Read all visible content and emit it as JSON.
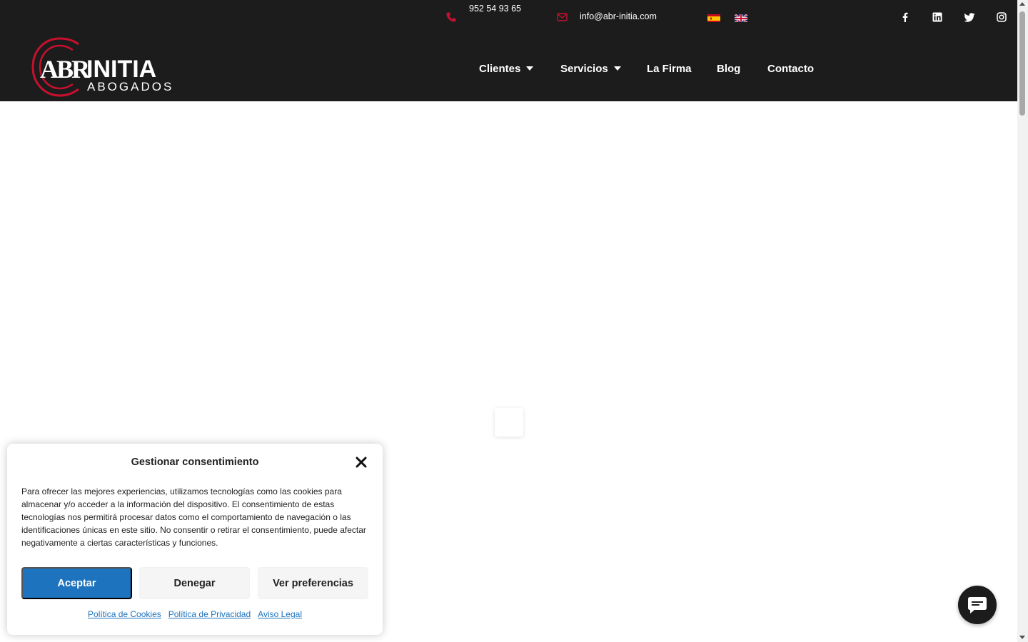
{
  "topbar": {
    "phone": "952 54 93 65",
    "email": "info@abr-initia.com"
  },
  "logo": {
    "abr": "ABR",
    "initia": "INITIA",
    "abogados": "ABOGADOS"
  },
  "nav": {
    "clientes": "Clientes",
    "servicios": "Servicios",
    "firma": "La Firma",
    "blog": "Blog",
    "contacto": "Contacto"
  },
  "consent": {
    "title": "Gestionar consentimiento",
    "body": "Para ofrecer las mejores experiencias, utilizamos tecnologías como las cookies para almacenar y/o acceder a la información del dispositivo. El consentimiento de estas tecnologías nos permitirá procesar datos como el comportamiento de navegación o las identificaciones únicas en este sitio. No consentir o retirar el consentimiento, puede afectar negativamente a ciertas características y funciones.",
    "accept": "Aceptar",
    "deny": "Denegar",
    "preferences": "Ver preferencias",
    "links": {
      "cookies": "Política de Cookies",
      "privacy": "Política de Privacidad",
      "legal": "Aviso Legal"
    }
  },
  "colors": {
    "header_bg": "#1c1c1c",
    "accent_red": "#c8102e",
    "button_blue": "#1e73be"
  },
  "icons": {
    "phone": "phone-icon",
    "mail": "mail-icon",
    "facebook": "facebook-icon",
    "linkedin": "linkedin-icon",
    "twitter": "twitter-icon",
    "instagram": "instagram-icon",
    "close": "close-icon",
    "chat": "chat-icon"
  }
}
